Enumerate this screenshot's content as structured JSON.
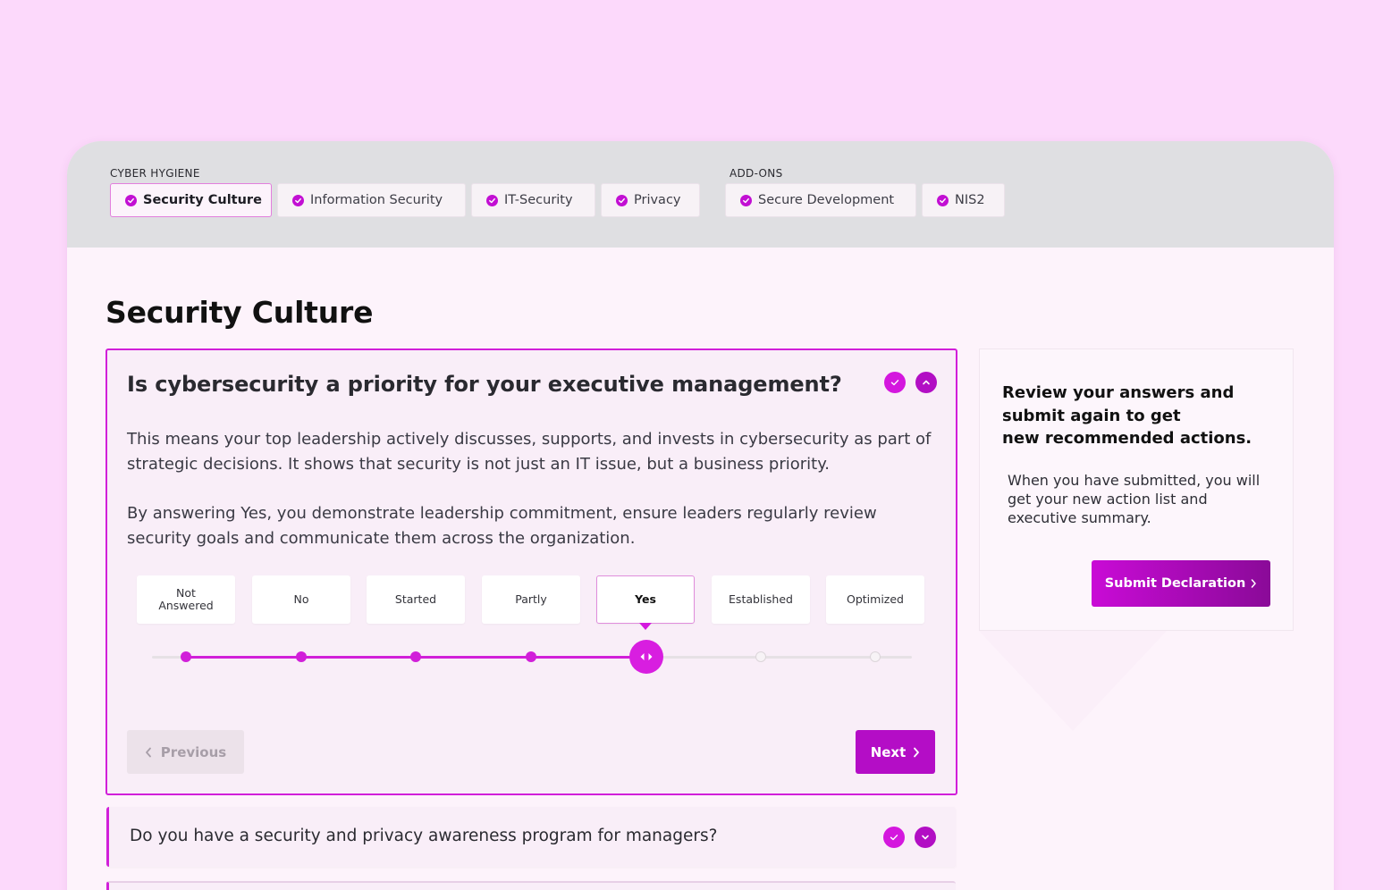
{
  "nav": {
    "group_cyber": "CYBER HYGIENE",
    "group_addons": "ADD-ONS",
    "tabs": [
      {
        "label": "Security Culture",
        "icon": "check-circle-icon",
        "active": true
      },
      {
        "label": "Information Security",
        "icon": "check-circle-icon"
      },
      {
        "label": "IT-Security",
        "icon": "check-circle-icon"
      },
      {
        "label": "Privacy",
        "icon": "check-circle-icon"
      },
      {
        "label": "Secure Development",
        "icon": "check-circle-icon"
      },
      {
        "label": "NIS2",
        "icon": "check-circle-icon"
      }
    ]
  },
  "page": {
    "title": "Security Culture"
  },
  "question": {
    "title": "Is cybersecurity a priority for your executive management?",
    "paragraphs": [
      "This means your top leadership actively discusses, supports, and invests in cybersecurity as part of strategic decisions. It shows that security is not just an IT issue, but a business priority.",
      "By answering Yes, you demonstrate leadership commitment, ensure leaders regularly review security goals and communicate them across the organization."
    ],
    "options": [
      "Not Answered",
      "No",
      "Started",
      "Partly",
      "Yes",
      "Established",
      "Optimized"
    ],
    "selected_option": "Yes",
    "selected_index": 4,
    "previous_label": "Previous",
    "next_label": "Next"
  },
  "question2": {
    "title": "Do you have a security and privacy awareness program for managers?"
  },
  "side_panel": {
    "heading_lines": [
      "Review your answers and",
      "submit again to get",
      "new recommended actions."
    ],
    "body": "When you have submitted, you will get your new action list and executive summary.",
    "submit_label": "Submit Declaration"
  },
  "colors": {
    "accent": "#d11fd9",
    "accent_dark": "#b40dc6",
    "background": "#fcd9fb",
    "topbar": "#dfdfe2"
  }
}
